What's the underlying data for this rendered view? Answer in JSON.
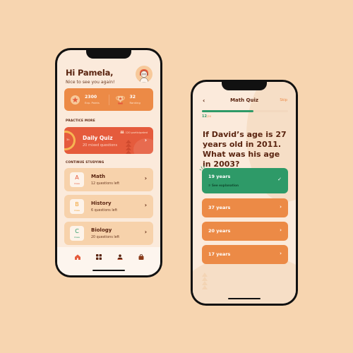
{
  "home": {
    "greeting": "Hi Pamela,",
    "subgreeting": "Nice to see you again!",
    "stats": [
      {
        "value": "2300",
        "label": "Exp. Points",
        "icon": "star-badge-icon"
      },
      {
        "value": "32",
        "label": "Ranking",
        "icon": "trophy-icon"
      }
    ],
    "practice_title": "PRACTICE MORE",
    "daily_quiz": {
      "title": "Daily Quiz",
      "subtitle": "20 mixed questions",
      "participants": "120 participated",
      "timer": "3h"
    },
    "continue_title": "CONTINUE STUDYING",
    "courses": [
      {
        "letter": "A",
        "tag": "Class",
        "name": "Math",
        "left": "12 questions left",
        "color": "#e55b3c"
      },
      {
        "letter": "B",
        "tag": "Class",
        "name": "History",
        "left": "6 questions left",
        "color": "#f0a030"
      },
      {
        "letter": "C",
        "tag": "Class",
        "name": "Biology",
        "left": "20 questions left",
        "color": "#2e9a68"
      }
    ],
    "tabs": [
      "home-icon",
      "grid-icon",
      "profile-icon",
      "bag-icon"
    ]
  },
  "quiz": {
    "back": "‹",
    "title": "Math Quiz",
    "skip": "Skip",
    "progress_current": "12",
    "progress_total": "/20",
    "progress_fraction": 0.6,
    "question": "If David’s age is 27 years old in 2011. What was his age in 2003?",
    "answers": [
      {
        "text": "19  years",
        "correct": true,
        "explanation": "See explanation"
      },
      {
        "text": "37 years",
        "correct": false
      },
      {
        "text": "20 years",
        "correct": false
      },
      {
        "text": "17 years",
        "correct": false
      }
    ]
  },
  "colors": {
    "background": "#f7d5b0",
    "accent_orange": "#ec8a46",
    "accent_red": "#e55b3c",
    "success_green": "#2e9a68",
    "text_brown": "#5a2410"
  }
}
